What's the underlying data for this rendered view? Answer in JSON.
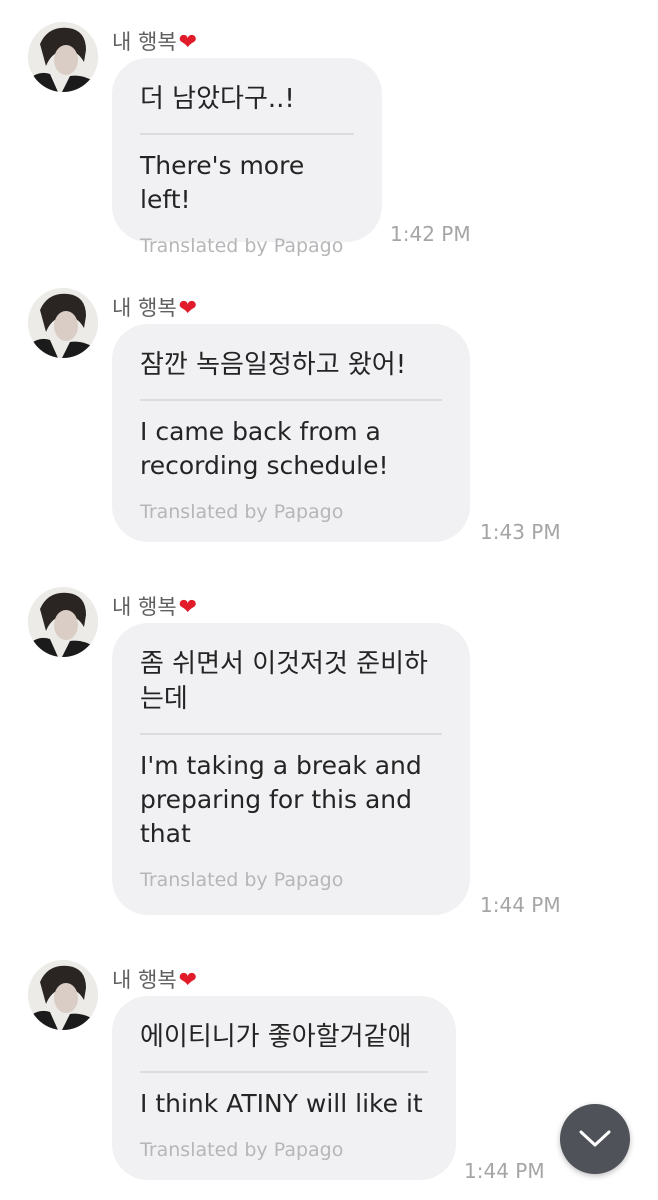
{
  "messages": [
    {
      "sender": "내 행복",
      "original": "더 남았다구..!",
      "translation": "There's more left!",
      "translated_by": "Translated by Papago",
      "time": "1:42 PM"
    },
    {
      "sender": "내 행복",
      "original": "잠깐 녹음일정하고 왔어!",
      "translation": "I came back from a recording schedule!",
      "translated_by": "Translated by Papago",
      "time": "1:43 PM"
    },
    {
      "sender": "내 행복",
      "original": "좀 쉬면서 이것저것 준비하는데",
      "translation": "I'm taking a break and preparing for this and that",
      "translated_by": "Translated by Papago",
      "time": "1:44 PM"
    },
    {
      "sender": "내 행복",
      "original": "에이티니가 좋아할거같애",
      "translation": "I think ATINY will like it",
      "translated_by": "Translated by Papago",
      "time": "1:44 PM"
    }
  ],
  "icons": {
    "heart": "red-heart-icon",
    "scroll_down": "chevron-down-icon",
    "avatar": "avatar"
  },
  "colors": {
    "bubble_bg": "#f1f1f3",
    "heart": "#e11b2a",
    "scroll_button": "#4f5258"
  }
}
